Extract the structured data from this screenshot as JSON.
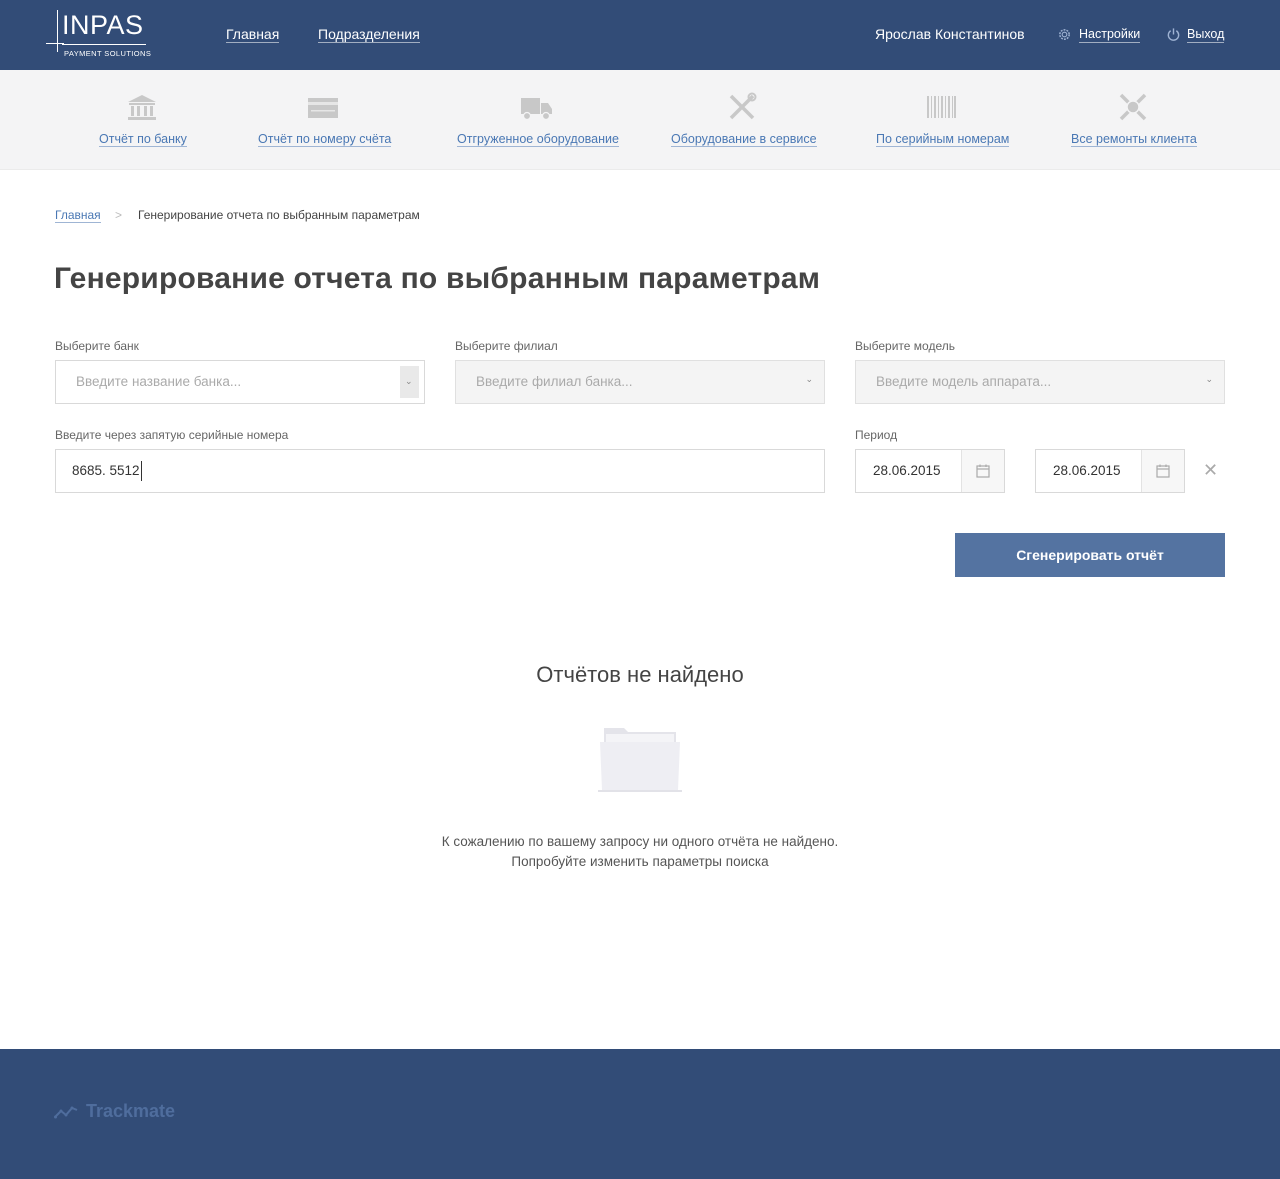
{
  "header": {
    "logo_text": "INPAS",
    "logo_sub": "PAYMENT SOLUTIONS",
    "nav": [
      "Главная",
      "Подразделения"
    ],
    "user_name": "Ярослав Константинов",
    "settings_label": "Настройки",
    "logout_label": "Выход"
  },
  "quick_reports": [
    {
      "label": "Отчёт по банку",
      "icon": "bank-icon"
    },
    {
      "label": "Отчёт по номеру счёта",
      "icon": "card-icon"
    },
    {
      "label": "Отгруженное оборудование",
      "icon": "truck-icon"
    },
    {
      "label": "Оборудование в сервисе",
      "icon": "tools-icon"
    },
    {
      "label": "По серийным номерам",
      "icon": "barcode-icon"
    },
    {
      "label": "Все ремонты клиента",
      "icon": "repair-icon"
    }
  ],
  "breadcrumb": {
    "home": "Главная",
    "separator": ">",
    "current": "Генерирование отчета по выбранным параметрам"
  },
  "page_title": "Генерирование отчета по выбранным параметрам",
  "form": {
    "bank": {
      "label": "Выберите банк",
      "placeholder": "Введите название банка..."
    },
    "branch": {
      "label": "Выберите филиал",
      "placeholder": "Введите филиал банка..."
    },
    "model": {
      "label": "Выберите модель",
      "placeholder": "Введите модель аппарата..."
    },
    "serials": {
      "label": "Введите через запятую серийные номера",
      "value": "8685. 5512"
    },
    "period": {
      "label": "Период",
      "from": "28.06.2015",
      "to": "28.06.2015"
    },
    "clear_symbol": "✕",
    "submit_label": "Сгенерировать отчёт"
  },
  "empty_state": {
    "title": "Отчётов не найдено",
    "line1": "К сожалению по вашему запросу ни одного отчёта не найдено.",
    "line2": "Попробуйте изменить параметры поиска"
  },
  "footer": {
    "brand": "Trackmate"
  },
  "colors": {
    "header_bg": "#324c77",
    "accent": "#5473a1",
    "link": "#4a78b4"
  }
}
